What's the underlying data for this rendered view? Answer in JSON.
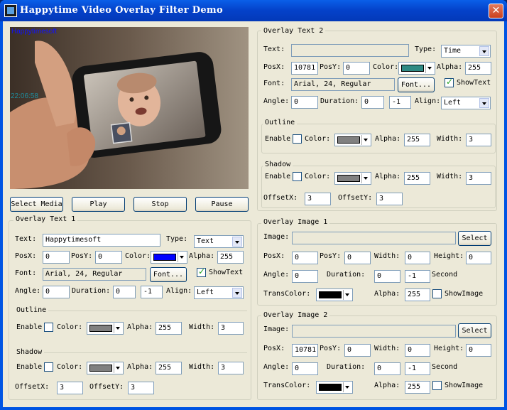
{
  "window": {
    "title": "Happytime Video Overlay Filter Demo",
    "close_glyph": "✕"
  },
  "preview": {
    "overlay_text": "Happytimesoft",
    "time_text": "22:06:58"
  },
  "controls": {
    "select_media": "Select Media",
    "play": "Play",
    "stop": "Stop",
    "pause": "Pause"
  },
  "labels": {
    "text": "Text:",
    "type": "Type:",
    "posx": "PosX:",
    "posy": "PosY:",
    "color": "Color:",
    "alpha": "Alpha:",
    "font": "Font:",
    "font_button": "Font...",
    "show_text": "ShowText",
    "angle": "Angle:",
    "duration": "Duration:",
    "align": "Align:",
    "outline": "Outline",
    "shadow": "Shadow",
    "enable": "Enable",
    "width": "Width:",
    "offsetx": "OffsetX:",
    "offsety": "OffsetY:",
    "image": "Image:",
    "select": "Select",
    "height": "Height:",
    "second": "Second",
    "trans_color": "TransColor:",
    "show_image": "ShowImage"
  },
  "overlay_text_1": {
    "title": "Overlay Text 1",
    "text": "Happytimesoft",
    "type": "Text",
    "posx": "0",
    "posy": "0",
    "color": "#0000ff",
    "alpha": "255",
    "font": "Arial, 24, Regular",
    "show_text": true,
    "angle": "0",
    "duration": "0",
    "duration2": "-1",
    "align": "Left",
    "outline": {
      "enabled": false,
      "color": "#808080",
      "alpha": "255",
      "width": "3"
    },
    "shadow": {
      "enabled": false,
      "color": "#808080",
      "alpha": "255",
      "width": "3",
      "offsetx": "3",
      "offsety": "3"
    }
  },
  "overlay_text_2": {
    "title": "Overlay Text 2",
    "text": "",
    "type": "Time",
    "posx": "10781",
    "posy": "0",
    "color": "#2e8a84",
    "alpha": "255",
    "font": "Arial, 24, Regular",
    "show_text": true,
    "angle": "0",
    "duration": "0",
    "duration2": "-1",
    "align": "Left",
    "outline": {
      "enabled": false,
      "color": "#808080",
      "alpha": "255",
      "width": "3"
    },
    "shadow": {
      "enabled": false,
      "color": "#808080",
      "alpha": "255",
      "width": "3",
      "offsetx": "3",
      "offsety": "3"
    }
  },
  "overlay_image_1": {
    "title": "Overlay Image 1",
    "image": "",
    "posx": "0",
    "posy": "0",
    "width": "0",
    "height": "0",
    "angle": "0",
    "duration": "0",
    "duration2": "-1",
    "trans_color": "#000000",
    "alpha": "255",
    "show_image": false
  },
  "overlay_image_2": {
    "title": "Overlay Image 2",
    "image": "",
    "posx": "10781",
    "posy": "0",
    "width": "0",
    "height": "0",
    "angle": "0",
    "duration": "0",
    "duration2": "-1",
    "trans_color": "#000000",
    "alpha": "255",
    "show_image": false
  }
}
